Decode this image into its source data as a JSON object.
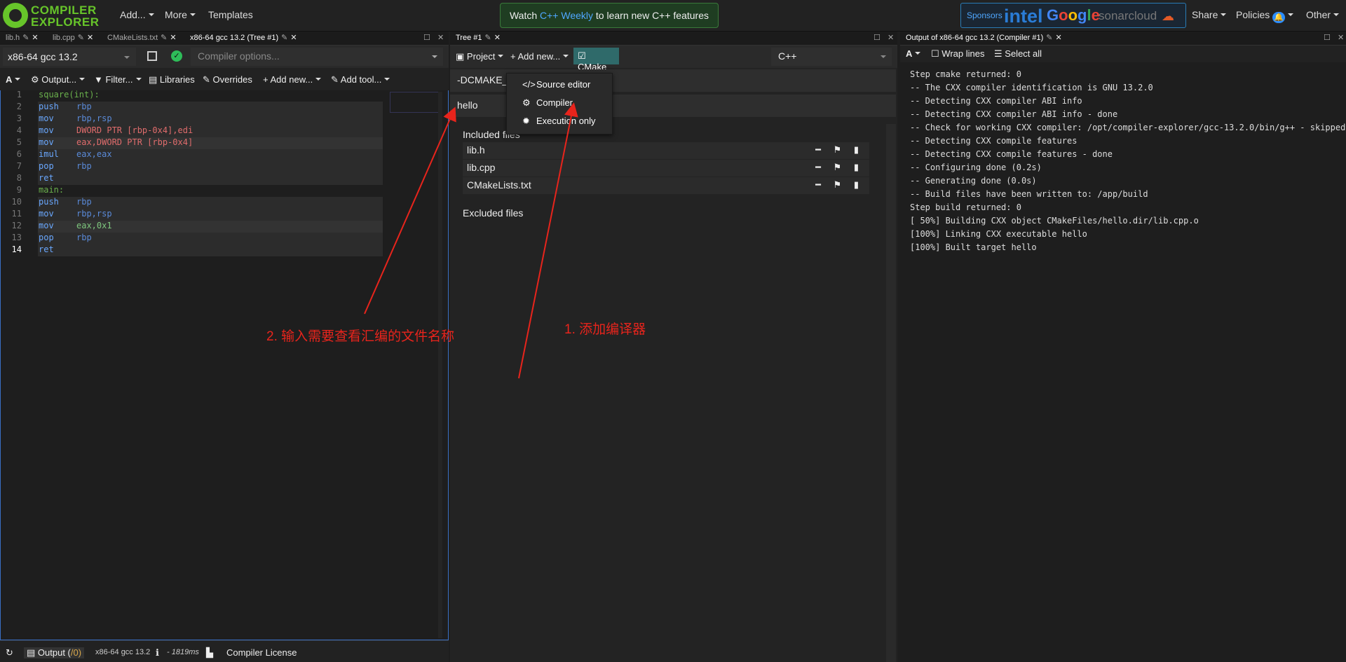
{
  "navbar": {
    "logo_line1": "COMPILER",
    "logo_line2": "EXPLORER",
    "add": "Add...",
    "more": "More",
    "templates": "Templates",
    "news_pre": "Watch ",
    "news_link": "C++ Weekly",
    "news_post": " to learn new C++ features",
    "sponsors_label": "Sponsors",
    "sponsor_intel": "intel",
    "sponsor_google": "Google",
    "sponsor_sonar": "sonarcloud",
    "share": "Share",
    "policies": "Policies",
    "other": "Other"
  },
  "left_tabs": [
    "lib.h",
    "lib.cpp",
    "CMakeLists.txt",
    "x86-64 gcc 13.2 (Tree #1)"
  ],
  "left": {
    "compiler": "x86-64 gcc 13.2",
    "options_placeholder": "Compiler options...",
    "toolbar": {
      "font": "A",
      "output": "Output...",
      "filter": "Filter...",
      "libraries": "Libraries",
      "overrides": "Overrides",
      "add_new": "Add new...",
      "add_tool": "Add tool..."
    },
    "lines": [
      {
        "n": "1",
        "label": "square(int):"
      },
      {
        "n": "2",
        "op": "push",
        "args": "rbp"
      },
      {
        "n": "3",
        "op": "mov",
        "args": "rbp,rsp"
      },
      {
        "n": "4",
        "op": "mov",
        "args": "DWORD PTR [rbp-0x4],edi"
      },
      {
        "n": "5",
        "op": "mov",
        "args": "eax,DWORD PTR [rbp-0x4]"
      },
      {
        "n": "6",
        "op": "imul",
        "args": "eax,eax"
      },
      {
        "n": "7",
        "op": "pop",
        "args": "rbp"
      },
      {
        "n": "8",
        "op": "ret",
        "args": ""
      },
      {
        "n": "9",
        "label": "main:"
      },
      {
        "n": "10",
        "op": "push",
        "args": "rbp"
      },
      {
        "n": "11",
        "op": "mov",
        "args": "rbp,rsp"
      },
      {
        "n": "12",
        "op": "mov",
        "args": "eax,0x1"
      },
      {
        "n": "13",
        "op": "pop",
        "args": "rbp"
      },
      {
        "n": "14",
        "op": "ret",
        "args": ""
      }
    ],
    "footer": {
      "output": "Output (",
      "output_count": "/0)",
      "compiler": "x86-64 gcc 13.2",
      "time": "- 1819ms",
      "license": "Compiler License"
    }
  },
  "mid_tabs": [
    "Tree #1"
  ],
  "mid": {
    "project": "Project",
    "add_new": "Add new...",
    "cmake": "CMake",
    "language": "C++",
    "cmake_args": "-DCMAKE_",
    "target": "hello",
    "included_files": "Included files",
    "excluded_files": "Excluded files",
    "files": [
      "lib.h",
      "lib.cpp",
      "CMakeLists.txt"
    ]
  },
  "dropdown": {
    "items": [
      "Source editor",
      "Compiler",
      "Execution only"
    ]
  },
  "right_tabs": [
    "Output of x86-64 gcc 13.2 (Compiler #1)"
  ],
  "right": {
    "font": "A",
    "wrap_lines": "Wrap lines",
    "select_all": "Select all",
    "output": [
      "Step cmake returned: 0",
      "-- The CXX compiler identification is GNU 13.2.0",
      "-- Detecting CXX compiler ABI info",
      "-- Detecting CXX compiler ABI info - done",
      "-- Check for working CXX compiler: /opt/compiler-explorer/gcc-13.2.0/bin/g++ - skipped",
      "-- Detecting CXX compile features",
      "-- Detecting CXX compile features - done",
      "-- Configuring done (0.2s)",
      "-- Generating done (0.0s)",
      "-- Build files have been written to: /app/build",
      "Step build returned: 0",
      "[ 50%] Building CXX object CMakeFiles/hello.dir/lib.cpp.o",
      "[100%] Linking CXX executable hello",
      "[100%] Built target hello"
    ]
  },
  "annotations": {
    "step1": "1. 添加编译器",
    "step2": "2. 输入需要查看汇编的文件名称"
  },
  "colors": {
    "accent_green": "#67c52a",
    "annotation_red": "#e8241c",
    "cmake_button": "#2f6a6a"
  }
}
